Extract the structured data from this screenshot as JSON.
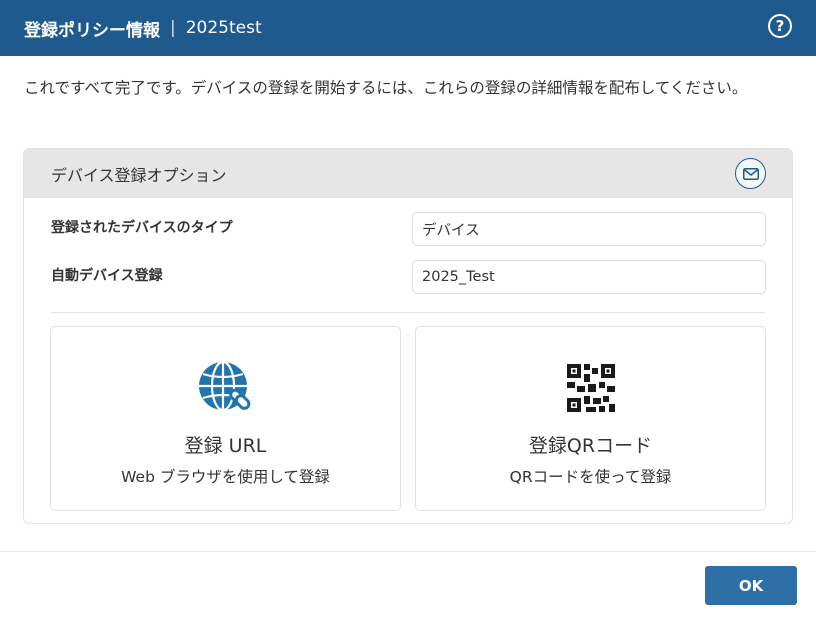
{
  "header": {
    "title": "登録ポリシー情報",
    "separator": "|",
    "policy_name": "2025test",
    "help_icon": "?"
  },
  "intro_text": "これですべて完了です。デバイスの登録を開始するには、これらの登録の詳細情報を配布してください。",
  "options_panel": {
    "title": "デバイス登録オプション",
    "mail_icon": "mail-icon",
    "fields": [
      {
        "label": "登録されたデバイスのタイプ",
        "value": "デバイス"
      },
      {
        "label": "自動デバイス登録",
        "value": "2025_Test"
      }
    ],
    "cards": [
      {
        "icon": "globe-link-icon",
        "title": "登録 URL",
        "subtitle": "Web ブラウザを使用して登録"
      },
      {
        "icon": "qr-code-icon",
        "title": "登録QRコード",
        "subtitle": "QRコードを使って登録"
      }
    ]
  },
  "footer": {
    "ok_label": "OK"
  },
  "colors": {
    "header_bg": "#1f5a8e",
    "accent": "#2f6fa8",
    "panel_head_bg": "#e6e6e6"
  }
}
